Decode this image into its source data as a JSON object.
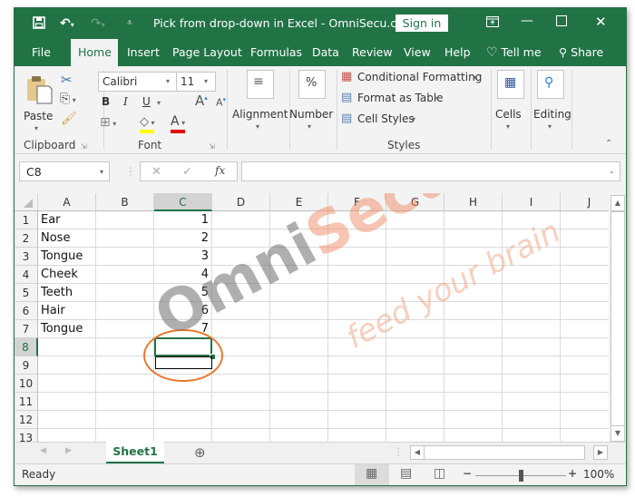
{
  "titlebar": {
    "title": "Pick from drop-down in Excel - OmniSecu.co...",
    "sign_in": "Sign in",
    "save_icon": "save-icon",
    "undo_icon": "undo-icon",
    "redo_icon": "redo-icon",
    "customize_icon": "customize-qat-icon"
  },
  "ribbon_tabs": [
    "File",
    "Home",
    "Insert",
    "Page Layout",
    "Formulas",
    "Data",
    "Review",
    "View",
    "Help",
    "Tell me",
    "Share"
  ],
  "active_tab": "Home",
  "ribbon": {
    "clipboard": {
      "paste": "Paste",
      "label": "Clipboard"
    },
    "font": {
      "font_name": "Calibri",
      "font_size": "11",
      "bold": "B",
      "italic": "I",
      "underline": "U",
      "label": "Font",
      "highlight_color": "#ffff00",
      "font_color": "#e00000"
    },
    "alignment": {
      "label": "Alignment"
    },
    "number": {
      "label": "Number",
      "icon_text": "%"
    },
    "styles": {
      "conditional_formatting": "Conditional Formatting",
      "format_as_table": "Format as Table",
      "cell_styles": "Cell Styles",
      "label": "Styles"
    },
    "cells": {
      "label": "Cells"
    },
    "editing": {
      "label": "Editing"
    }
  },
  "formula_bar": {
    "name_box": "C8",
    "fx": "fx",
    "formula": ""
  },
  "columns": [
    "A",
    "B",
    "C",
    "D",
    "E",
    "F",
    "G",
    "H",
    "I",
    "J"
  ],
  "selected_column": "C",
  "selected_row": "8",
  "rows": [
    {
      "num": "1",
      "a": "Ear",
      "c": "1"
    },
    {
      "num": "2",
      "a": "Nose",
      "c": "2"
    },
    {
      "num": "3",
      "a": "Tongue",
      "c": "3"
    },
    {
      "num": "4",
      "a": "Cheek",
      "c": "4"
    },
    {
      "num": "5",
      "a": "Teeth",
      "c": "5"
    },
    {
      "num": "6",
      "a": "Hair",
      "c": "6"
    },
    {
      "num": "7",
      "a": "Tongue",
      "c": "7"
    },
    {
      "num": "8",
      "a": "",
      "c": ""
    },
    {
      "num": "9",
      "a": "",
      "c": ""
    },
    {
      "num": "10",
      "a": "",
      "c": ""
    },
    {
      "num": "11",
      "a": "",
      "c": ""
    },
    {
      "num": "12",
      "a": "",
      "c": ""
    },
    {
      "num": "13",
      "a": "",
      "c": ""
    }
  ],
  "sheets": [
    "Sheet1"
  ],
  "status": {
    "text": "Ready",
    "zoom": "100%",
    "zoom_level_percent": 100
  },
  "watermark": {
    "brand_gray": "Omni",
    "brand_orange": "Secu.com",
    "tagline": "feed your brain"
  },
  "colors": {
    "accent": "#217346",
    "highlight_circle": "#e8782a"
  }
}
